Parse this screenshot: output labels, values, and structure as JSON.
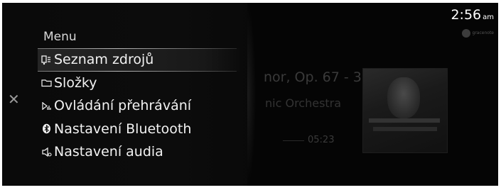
{
  "status": {
    "time": "2:56",
    "ampm": "am",
    "source_badge": "gracenote"
  },
  "now_playing": {
    "track": "nor, Op. 67 - 3...",
    "artist": "nic Orchestra",
    "elapsed": "05:23"
  },
  "menu": {
    "title": "Menu",
    "close_icon": "close-x",
    "items": [
      {
        "label": "Seznam zdrojů",
        "icon": "source-list-icon",
        "selected": true
      },
      {
        "label": "Složky",
        "icon": "folder-icon",
        "selected": false
      },
      {
        "label": "Ovládání přehrávání",
        "icon": "playback-control-icon",
        "selected": false
      },
      {
        "label": "Nastavení Bluetooth",
        "icon": "bluetooth-icon",
        "selected": false
      },
      {
        "label": "Nastavení audia",
        "icon": "speaker-icon",
        "selected": false
      }
    ]
  },
  "colors": {
    "background": "#050505",
    "text": "#f2f2f2",
    "muted": "#3a3a3a"
  }
}
